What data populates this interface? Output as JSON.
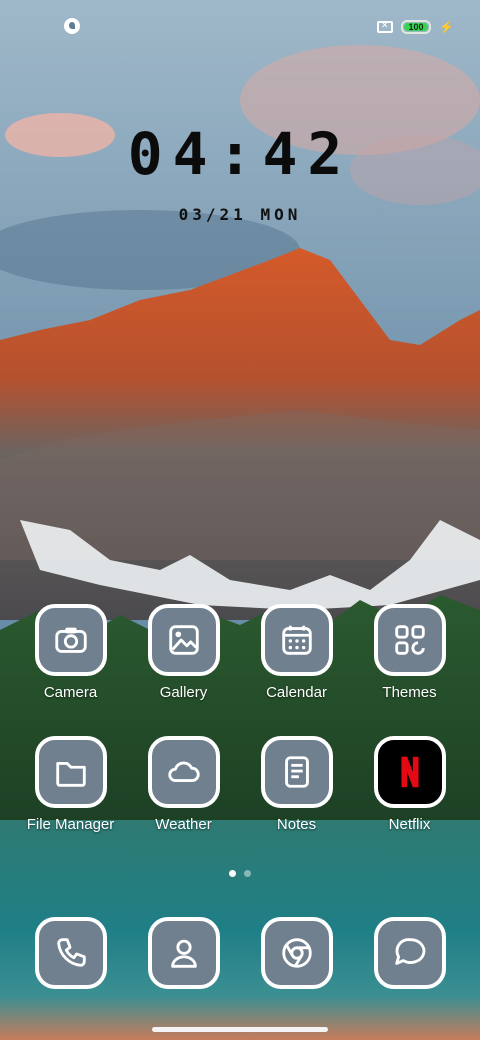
{
  "status_bar": {
    "left_icon": "chat-bubble-icon",
    "sim_icon": "sim-disabled-icon",
    "battery_level": "100",
    "battery_fraction": 1.0,
    "charging_icon": "bolt-icon"
  },
  "lockclock": {
    "time": "04:42",
    "date": "03/21 MON"
  },
  "apps": [
    {
      "label": "Camera",
      "icon": "camera-icon"
    },
    {
      "label": "Gallery",
      "icon": "gallery-icon"
    },
    {
      "label": "Calendar",
      "icon": "calendar-icon"
    },
    {
      "label": "Themes",
      "icon": "themes-icon"
    },
    {
      "label": "File Manager",
      "icon": "folder-icon"
    },
    {
      "label": "Weather",
      "icon": "cloud-icon"
    },
    {
      "label": "Notes",
      "icon": "notes-icon"
    },
    {
      "label": "Netflix",
      "icon": "netflix-icon"
    }
  ],
  "dock": [
    {
      "icon": "phone-icon"
    },
    {
      "icon": "contacts-icon"
    },
    {
      "icon": "chrome-icon"
    },
    {
      "icon": "messages-icon"
    }
  ],
  "page_indicator": {
    "pages": 2,
    "current": 1
  },
  "colors": {
    "netflix_red": "#e50914",
    "battery_green": "#39d353",
    "icon_bg": "#71808f"
  }
}
